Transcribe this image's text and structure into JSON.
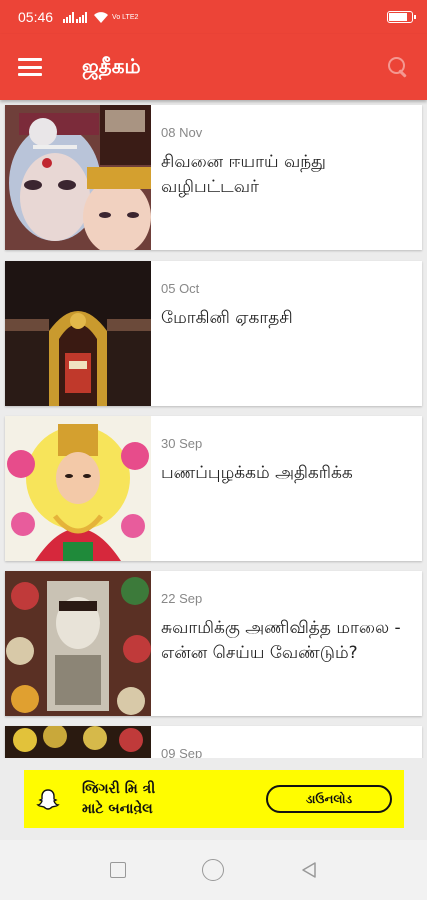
{
  "status_bar": {
    "time": "05:46",
    "network_label": "Vo LTE2",
    "battery_level": 0.75
  },
  "app_bar": {
    "title": "ஜதீகம்",
    "menu_icon": "menu-icon",
    "search_icon": "search-icon"
  },
  "articles": [
    {
      "date": "08 Nov",
      "title": "சிவனை ஈயாய் வந்து வழிபட்டவர்"
    },
    {
      "date": "05 Oct",
      "title": "மோகினி ஏகாதசி"
    },
    {
      "date": "30 Sep",
      "title": "பணப்புழக்கம் அதிகரிக்க"
    },
    {
      "date": "22 Sep",
      "title": "சுவாமிக்கு அணிவித்த மாலை - என்ன செய்ய வேண்டும்?"
    },
    {
      "date": "09 Sep",
      "title": ""
    }
  ],
  "ad": {
    "line1": "જિગરી મિ ત્રી",
    "line2": "માટે બનાવે઼ેલ",
    "cta": "ડાઉનલોડ",
    "brand_color": "#fffc00"
  },
  "nav_bar": {
    "icons": [
      "recent-apps-icon",
      "home-icon",
      "back-icon"
    ]
  },
  "colors": {
    "primary": "#ec4437",
    "date_text": "#888888"
  }
}
